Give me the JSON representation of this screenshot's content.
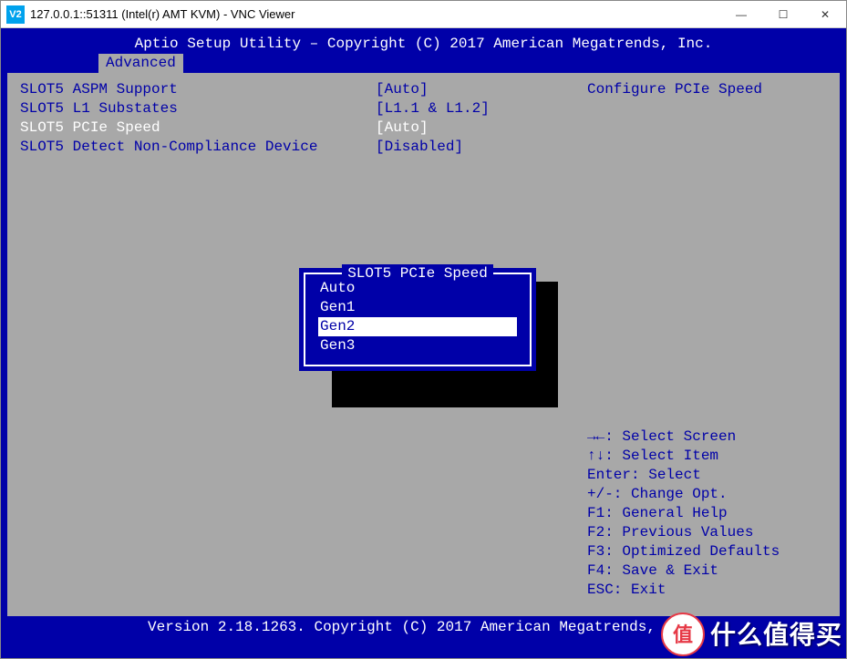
{
  "window": {
    "icon_text": "V2",
    "title": "127.0.0.1::51311 (Intel(r) AMT KVM) - VNC Viewer",
    "minimize_glyph": "—",
    "maximize_glyph": "☐",
    "close_glyph": "✕"
  },
  "bios": {
    "header": "Aptio Setup Utility – Copyright (C) 2017 American Megatrends, Inc.",
    "tab": "Advanced",
    "settings": [
      {
        "label": "SLOT5 ASPM Support",
        "value": "[Auto]",
        "selected": false
      },
      {
        "label": "SLOT5 L1 Substates",
        "value": "[L1.1 & L1.2]",
        "selected": false
      },
      {
        "label": "SLOT5 PCIe Speed",
        "value": "[Auto]",
        "selected": true
      },
      {
        "label": "SLOT5 Detect Non-Compliance Device",
        "value": "[Disabled]",
        "selected": false
      }
    ],
    "help_title": "Configure PCIe Speed",
    "help_keys": [
      "→←: Select Screen",
      "↑↓: Select Item",
      "Enter: Select",
      "+/-: Change Opt.",
      "F1: General Help",
      "F2: Previous Values",
      "F3: Optimized Defaults",
      "F4: Save & Exit",
      "ESC: Exit"
    ],
    "footer": "Version 2.18.1263. Copyright (C) 2017 American Megatrends, Inc."
  },
  "popup": {
    "title": "SLOT5 PCIe Speed",
    "options": [
      {
        "label": "Auto",
        "selected": false
      },
      {
        "label": "Gen1",
        "selected": false
      },
      {
        "label": "Gen2",
        "selected": true
      },
      {
        "label": "Gen3",
        "selected": false
      }
    ]
  },
  "watermark": {
    "badge": "值",
    "text": "什么值得买"
  }
}
